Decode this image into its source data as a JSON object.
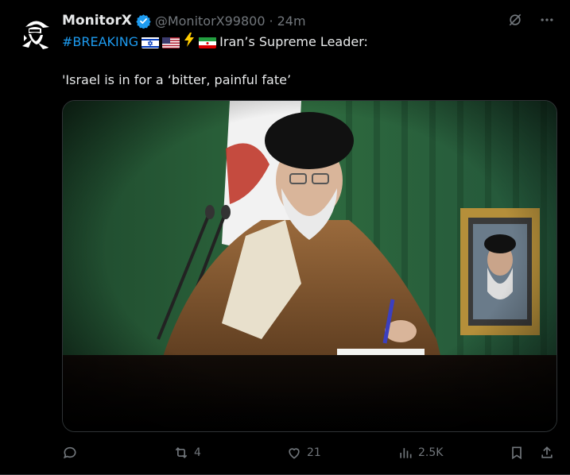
{
  "post": {
    "author": {
      "display_name": "MonitorX",
      "handle": "@MonitorX99800",
      "separator": "·",
      "time": "24m",
      "verified": true
    },
    "text": {
      "hashtag": "#BREAKING",
      "headline": "Iran’s Supreme Leader:",
      "quote": "'Israel is in for a ‘bitter, painful fate’"
    },
    "flags": [
      "israel-flag",
      "usa-flag",
      "lightning-emoji",
      "iran-flag"
    ],
    "media": {
      "type": "photo",
      "description_icon": "photo-media"
    },
    "metrics": {
      "replies": "",
      "reposts": "4",
      "likes": "21",
      "views": "2.5K"
    }
  },
  "colors": {
    "background": "#000000",
    "text": "#e7e9ea",
    "muted": "#71767b",
    "accent": "#1d9bf0",
    "verified": "#1d9bf0"
  }
}
